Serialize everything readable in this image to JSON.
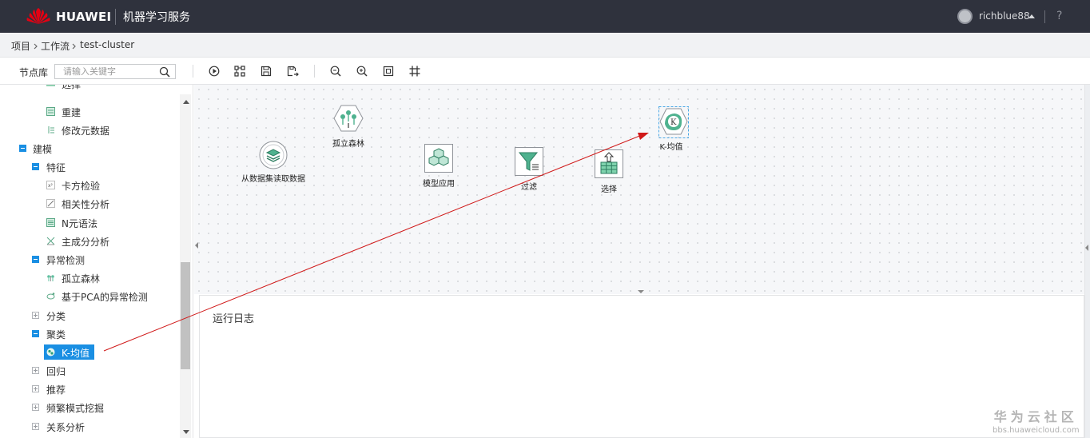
{
  "header": {
    "brand": "HUAWEI",
    "service": "机器学习服务",
    "username": "richblue88",
    "help": "?",
    "colors": {
      "bar": "#2f323d",
      "logo": "#e60012"
    }
  },
  "breadcrumb": {
    "items": [
      "项目",
      "工作流",
      "test-cluster"
    ]
  },
  "toolbar": {
    "library_label": "节点库",
    "search_placeholder": "请输入关键字",
    "icons": [
      "run-icon",
      "layout-icon",
      "save-icon",
      "save-as-icon",
      "zoom-out-icon",
      "zoom-in-icon",
      "fit-icon",
      "grid-icon"
    ]
  },
  "tree": {
    "items": [
      {
        "label": "选择",
        "type": "leaf",
        "icon": "select-icon"
      },
      {
        "label": "重建",
        "type": "leaf",
        "icon": "rebuild-icon"
      },
      {
        "label": "修改元数据",
        "type": "leaf",
        "icon": "metadata-icon"
      },
      {
        "label": "建模",
        "type": "expanded"
      },
      {
        "label": "特征",
        "type": "expanded"
      },
      {
        "label": "卡方检验",
        "type": "leaf",
        "icon": "chi-square-icon"
      },
      {
        "label": "相关性分析",
        "type": "leaf",
        "icon": "correlation-icon"
      },
      {
        "label": "N元语法",
        "type": "leaf",
        "icon": "ngram-icon"
      },
      {
        "label": "主成分分析",
        "type": "leaf",
        "icon": "pca-icon"
      },
      {
        "label": "异常检测",
        "type": "expanded"
      },
      {
        "label": "孤立森林",
        "type": "leaf",
        "icon": "isolation-forest-icon"
      },
      {
        "label": "基于PCA的异常检测",
        "type": "leaf",
        "icon": "pca-anomaly-icon"
      },
      {
        "label": "分类",
        "type": "collapsed"
      },
      {
        "label": "聚类",
        "type": "expanded"
      },
      {
        "label": "K-均值",
        "type": "leaf",
        "icon": "kmeans-icon",
        "selected": true
      },
      {
        "label": "回归",
        "type": "collapsed"
      },
      {
        "label": "推荐",
        "type": "collapsed"
      },
      {
        "label": "频繁模式挖掘",
        "type": "collapsed"
      },
      {
        "label": "关系分析",
        "type": "collapsed"
      }
    ]
  },
  "canvas": {
    "nodes": [
      {
        "label": "从数据集读取数据",
        "icon": "dataset-read-icon"
      },
      {
        "label": "孤立森林",
        "icon": "isolation-forest-icon"
      },
      {
        "label": "模型应用",
        "icon": "model-apply-icon"
      },
      {
        "label": "过滤",
        "icon": "filter-icon"
      },
      {
        "label": "选择",
        "icon": "select-icon"
      },
      {
        "label": "K-均值",
        "icon": "kmeans-icon"
      }
    ]
  },
  "log": {
    "title": "运行日志"
  },
  "watermark": {
    "cn": "华为云社区",
    "url": "bbs.huaweicloud.com"
  }
}
